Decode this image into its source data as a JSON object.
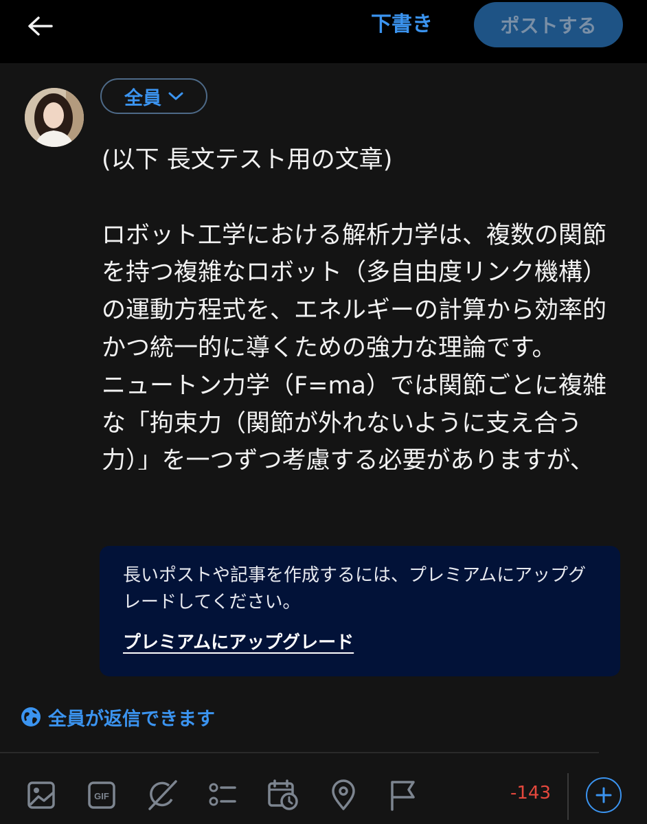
{
  "header": {
    "back_icon": "arrow-left-icon",
    "draft_label": "下書き",
    "post_label": "ポストする"
  },
  "composer": {
    "audience_label": "全員",
    "heading": "(以下 長文テスト用の文章)",
    "body": "ロボット工学における解析力学は、複数の関節を持つ複雑なロボット（多自由度リンク機構）の運動方程式を、エネルギーの計算から効率的かつ統一的に導くための強力な理論です。\nニュートン力学（F=ma）では関節ごとに複雑な「拘束力（関節が外れないように支え合う力）」を一つずつ考慮する必要がありますが、解析力学を用いればそ"
  },
  "upgrade_banner": {
    "message": "長いポストや記事を作成するには、プレミアムにアップグレードしてください。",
    "link_label": "プレミアムにアップグレード"
  },
  "reply_setting": {
    "icon": "globe-icon",
    "label": "全員が返信できます"
  },
  "toolbar": {
    "icons": [
      "image-icon",
      "gif-icon",
      "grok-icon",
      "poll-icon",
      "schedule-icon",
      "location-icon",
      "flag-icon"
    ],
    "char_count": "-143",
    "add_icon": "plus-icon"
  },
  "colors": {
    "accent": "#3b94f0",
    "background": "#141414",
    "banner": "#021238",
    "over_limit": "#e5483d",
    "post_button_disabled": "#1e5385"
  }
}
